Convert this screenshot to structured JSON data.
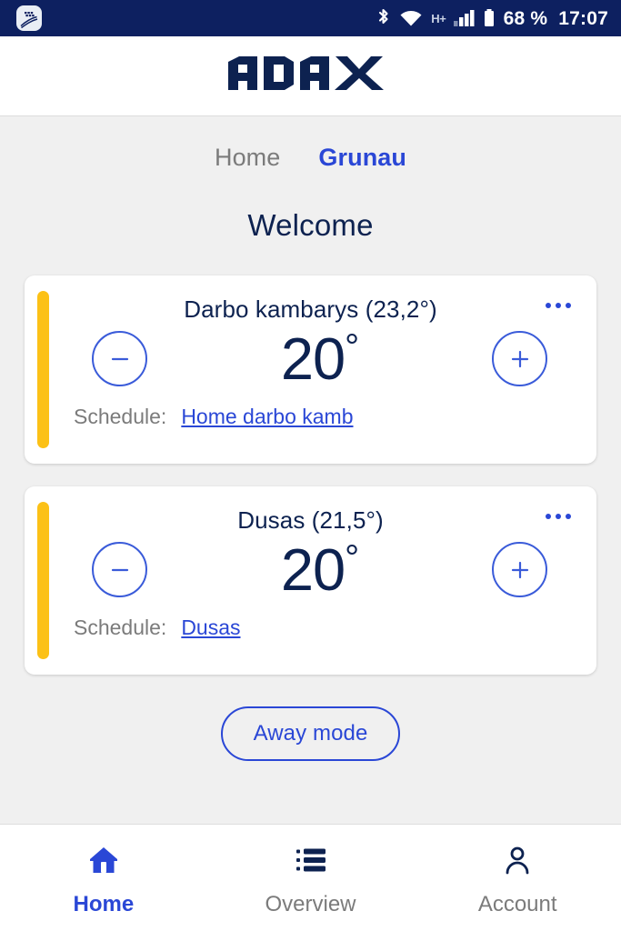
{
  "statusbar": {
    "app_icon": "blackberry-hub-icon",
    "bluetooth_icon": "bluetooth-icon",
    "wifi_icon": "wifi-icon",
    "network_type": "H+",
    "signal_icon": "cellular-signal-icon",
    "battery_icon": "battery-icon",
    "battery_level": "68 %",
    "time": "17:07",
    "background_color": "#0d2060"
  },
  "header": {
    "logo_text": "ADAX",
    "logo_color": "#0d2250"
  },
  "tabs": [
    {
      "label": "Home",
      "active": false
    },
    {
      "label": "Grunau",
      "active": true
    }
  ],
  "page_title": "Welcome",
  "accent_colors": {
    "blue": "#2a47d6",
    "navy": "#0d2250",
    "yellow": "#fcc116",
    "gray_text": "#7b7b7b"
  },
  "devices": [
    {
      "name": "Darbo kambarys (23,2°)",
      "current_temp": "23,2°",
      "target_temp": "20",
      "degree_symbol": "°",
      "decrease_label": "−",
      "increase_label": "+",
      "menu_icon": "more-options-icon",
      "schedule_label": "Schedule:",
      "schedule_name": "Home darbo kamb",
      "status_color": "#fcc116"
    },
    {
      "name": "Dusas (21,5°)",
      "current_temp": "21,5°",
      "target_temp": "20",
      "degree_symbol": "°",
      "decrease_label": "−",
      "increase_label": "+",
      "menu_icon": "more-options-icon",
      "schedule_label": "Schedule:",
      "schedule_name": "Dusas",
      "status_color": "#fcc116"
    }
  ],
  "away_button": {
    "label": "Away mode"
  },
  "bottom_nav": [
    {
      "label": "Home",
      "icon": "home-icon",
      "active": true
    },
    {
      "label": "Overview",
      "icon": "list-icon",
      "active": false
    },
    {
      "label": "Account",
      "icon": "person-icon",
      "active": false
    }
  ]
}
